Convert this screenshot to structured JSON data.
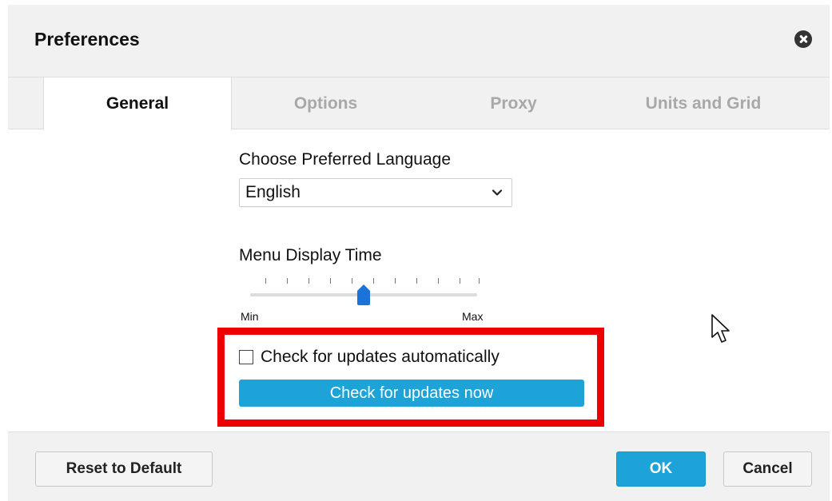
{
  "dialog": {
    "title": "Preferences"
  },
  "tabs": [
    {
      "label": "General",
      "active": true
    },
    {
      "label": "Options",
      "active": false
    },
    {
      "label": "Proxy",
      "active": false
    },
    {
      "label": "Units and Grid",
      "active": false
    }
  ],
  "general": {
    "language_label": "Choose Preferred Language",
    "language_value": "English",
    "menu_time_label": "Menu Display Time",
    "slider_min_label": "Min",
    "slider_max_label": "Max",
    "slider_value_fraction": 0.5,
    "auto_update_label": "Check for updates automatically",
    "auto_update_checked": false,
    "update_now_label": "Check for updates now"
  },
  "footer": {
    "reset_label": "Reset to Default",
    "ok_label": "OK",
    "cancel_label": "Cancel"
  },
  "colors": {
    "accent": "#1da3d8",
    "highlight": "#ee0000",
    "slider_thumb": "#1a73d9"
  },
  "icons": {
    "close": "close-icon",
    "dropdown": "chevron-down-icon",
    "cursor": "mouse-pointer-icon"
  }
}
